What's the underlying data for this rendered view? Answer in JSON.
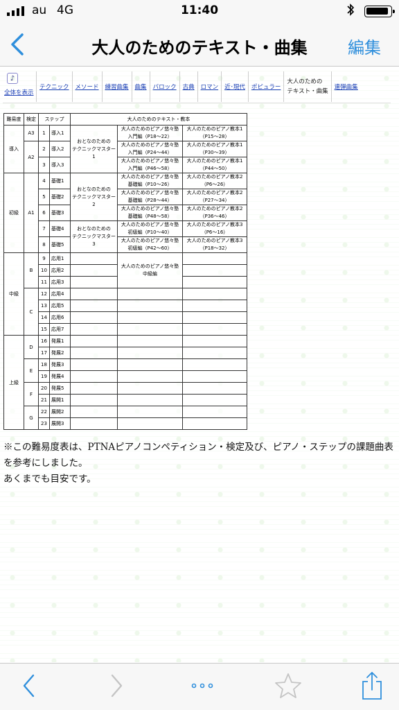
{
  "status": {
    "carrier": "au",
    "network": "4G",
    "time": "11:40"
  },
  "nav": {
    "title": "大人のためのテキスト・曲集",
    "edit": "編集"
  },
  "menu": {
    "home": "全体を表示",
    "items": [
      "テクニック",
      "メソード",
      "練習曲集",
      "曲集",
      "バロック",
      "古典",
      "ロマン",
      "近･現代",
      "ポピュラー"
    ],
    "current": [
      "大人のための",
      "テキスト・曲集"
    ],
    "last": "連弾曲集"
  },
  "table": {
    "headers": {
      "level": "難易度",
      "grade": "検定",
      "step": "ステップ",
      "text": "大人のためのテキスト・教本"
    },
    "levels": [
      "導入",
      "初級",
      "中級",
      "上級"
    ],
    "grades": [
      "A3",
      "A2",
      "A1",
      "B",
      "C",
      "D",
      "E",
      "F",
      "G"
    ],
    "steps": [
      {
        "no": "1",
        "name": "導入1"
      },
      {
        "no": "2",
        "name": "導入2"
      },
      {
        "no": "3",
        "name": "導入3"
      },
      {
        "no": "4",
        "name": "基礎1"
      },
      {
        "no": "5",
        "name": "基礎2"
      },
      {
        "no": "6",
        "name": "基礎3"
      },
      {
        "no": "7",
        "name": "基礎4"
      },
      {
        "no": "8",
        "name": "基礎5"
      },
      {
        "no": "9",
        "name": "応用1"
      },
      {
        "no": "10",
        "name": "応用2"
      },
      {
        "no": "11",
        "name": "応用3"
      },
      {
        "no": "12",
        "name": "応用4"
      },
      {
        "no": "13",
        "name": "応用5"
      },
      {
        "no": "14",
        "name": "応用6"
      },
      {
        "no": "15",
        "name": "応用7"
      },
      {
        "no": "16",
        "name": "発展1"
      },
      {
        "no": "17",
        "name": "発展2"
      },
      {
        "no": "18",
        "name": "発展3"
      },
      {
        "no": "19",
        "name": "発展4"
      },
      {
        "no": "20",
        "name": "発展5"
      },
      {
        "no": "21",
        "name": "展開1"
      },
      {
        "no": "22",
        "name": "展開2"
      },
      {
        "no": "23",
        "name": "展開3"
      }
    ],
    "books": {
      "tm1": "おとなのための\nテクニックマスター1",
      "tm2": "おとなのための\nテクニックマスター2",
      "tm3": "おとなのための\nテクニックマスター3",
      "yuyu": [
        "大人のためのピアノ悠々塾\n入門編（P18〜22）",
        "大人のためのピアノ悠々塾\n入門編（P24〜44）",
        "大人のためのピアノ悠々塾\n入門編（P46〜58）",
        "大人のためのピアノ悠々塾\n基礎編（P10〜26）",
        "大人のためのピアノ悠々塾\n基礎編（P28〜44）",
        "大人のためのピアノ悠々塾\n基礎編（P48〜58）",
        "大人のためのピアノ悠々塾\n初級編（P10〜40）",
        "大人のためのピアノ悠々塾\n初級編（P42〜60）",
        "大人のためのピアノ悠々塾\n中級編"
      ],
      "kyohon": [
        "大人のためのピアノ教本1\n（P15〜28）",
        "大人のためのピアノ教本1\n（P30〜39）",
        "大人のためのピアノ教本1\n（P44〜50）",
        "大人のためのピアノ教本2\n（P6〜26）",
        "大人のためのピアノ教本2\n（P27〜34）",
        "大人のためのピアノ教本2\n（P36〜46）",
        "大人のためのピアノ教本3\n（P6〜16）",
        "大人のためのピアノ教本3\n（P18〜32）"
      ]
    }
  },
  "note": [
    "※この難易度表は、PTNAピアノコンペティション・検定及び、ピアノ・ステップの課題曲表を参考にしました。",
    "あくまでも目安です。"
  ]
}
